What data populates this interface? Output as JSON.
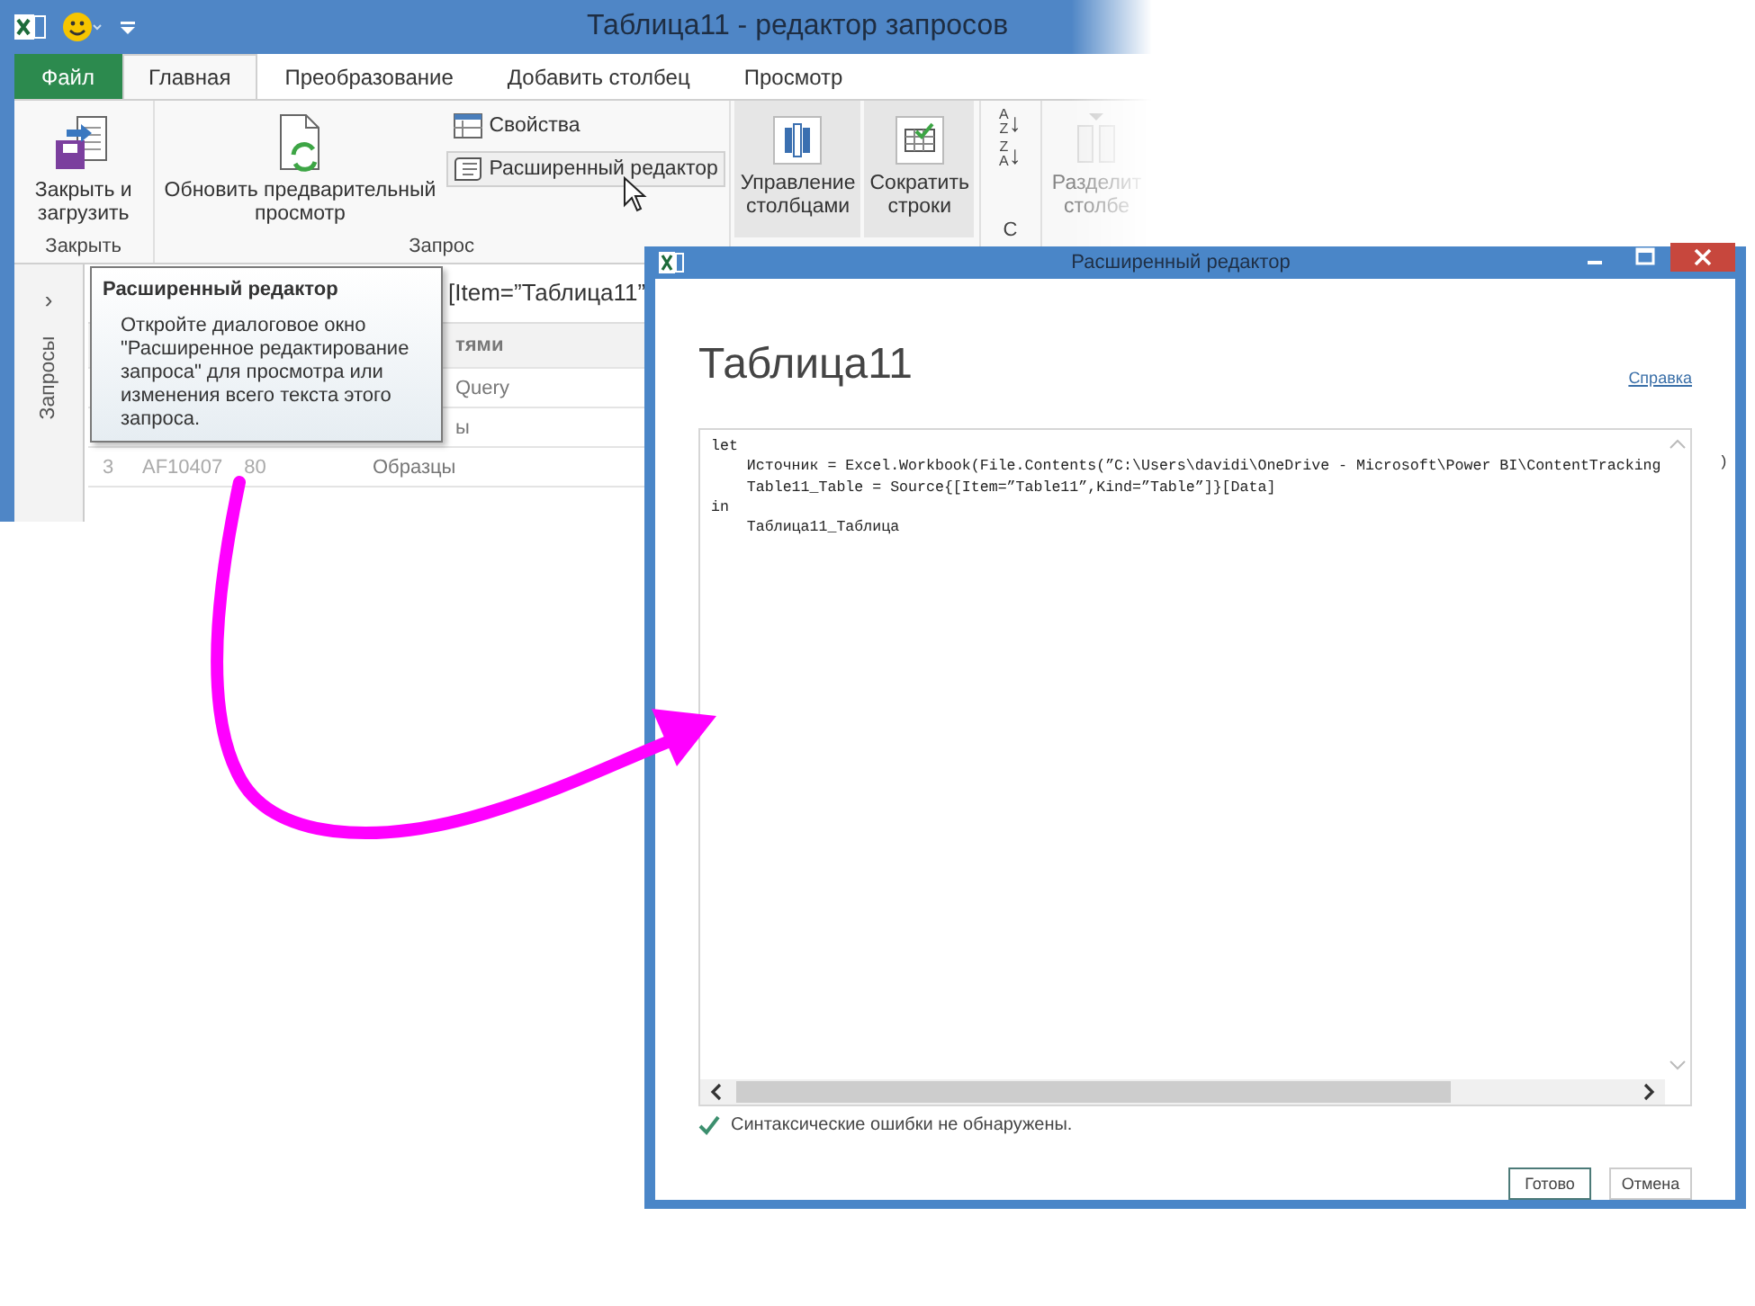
{
  "app_window": {
    "title": "Таблица11 - редактор запросов"
  },
  "ribbon_tabs": [
    {
      "label": "Файл",
      "selected": false,
      "kind": "file"
    },
    {
      "label": "Главная",
      "selected": true,
      "kind": "tab"
    },
    {
      "label": "Преобразование",
      "selected": false,
      "kind": "tab"
    },
    {
      "label": "Добавить столбец",
      "selected": false,
      "kind": "tab"
    },
    {
      "label": "Просмотр",
      "selected": false,
      "kind": "tab"
    }
  ],
  "ribbon": {
    "close_load": {
      "lines": [
        "Закрыть и",
        "загрузить"
      ]
    },
    "close_group_label": "Закрыть",
    "refresh_preview": {
      "lines": [
        "Обновить предварительный",
        "просмотр"
      ]
    },
    "properties": {
      "label": "Свойства",
      "hovered": false
    },
    "advanced_editor": {
      "label": "Расширенный редактор",
      "hovered": true
    },
    "query_group_label": "Запрос",
    "manage_columns": {
      "lines": [
        "Управление",
        "столбцами"
      ]
    },
    "reduce_rows": {
      "lines": [
        "Сократить",
        "строки"
      ]
    },
    "sort_buttons": [
      {
        "top": "A",
        "bottom": "Z",
        "arrow": "↓"
      },
      {
        "top": "Z",
        "bottom": "A",
        "arrow": "↓"
      }
    ],
    "sort_group_label": "С",
    "split_column": {
      "lines": [
        "Разделит",
        "столбе"
      ],
      "disabled": true
    }
  },
  "queries_pane": {
    "expander": "›",
    "label": "Запросы"
  },
  "formula": "[Item=”Таблица11”",
  "table": {
    "column_3_header": "тями",
    "rows": [
      {
        "number": "",
        "column_2": "",
        "column_2_end": "",
        "column_3": "Query"
      },
      {
        "number": "",
        "column_2": "",
        "column_2_end": "",
        "column_3": "ы"
      },
      {
        "number": "3",
        "column_2": "AF10407",
        "column_2_end": "80",
        "column_3": "Образцы"
      }
    ]
  },
  "tooltip": {
    "title": "Расширенный редактор",
    "body": "Откройте диалоговое окно \"Расширенное редактирование запроса\" для просмотра или изменения всего текста этого запроса."
  },
  "dialog": {
    "title": "Расширенный редактор",
    "heading": "Таблица11",
    "help_link": "Справка",
    "code_lines": [
      "let",
      "    Источник = Excel.Workbook(File.Contents(”C:\\Users\\davidi\\OneDrive - Microsoft\\Power BI\\ContentTracking",
      "    Table11_Table = Source{[Item=”Table11”,Kind=”Table”]}[Data]",
      "in",
      "    Таблица11_Таблица"
    ],
    "code_overflow": ")",
    "status": "Синтаксические ошибки не обнаружены.",
    "buttons": [
      {
        "label": "Готово",
        "default": true
      },
      {
        "label": "Отмена",
        "default": false
      }
    ]
  }
}
